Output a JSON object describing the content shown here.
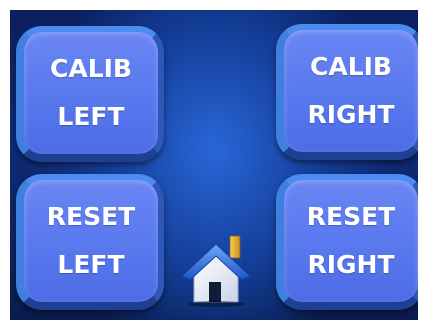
{
  "buttons": {
    "calib_left": {
      "line1": "CALIB",
      "line2": "LEFT"
    },
    "calib_right": {
      "line1": "CALIB",
      "line2": "RIGHT"
    },
    "reset_left": {
      "line1": "RESET",
      "line2": "LEFT"
    },
    "reset_right": {
      "line1": "RESET",
      "line2": "RIGHT"
    }
  },
  "home": {
    "icon": "home-icon"
  },
  "colors": {
    "background_dark": "#0b1f5c",
    "background_glow": "#2a66d8",
    "button_fill": "#5878ee",
    "button_border": "#3f7fe0",
    "label_text": "#ffffff",
    "roof": "#2f6fe0",
    "chimney": "#e8b030"
  }
}
